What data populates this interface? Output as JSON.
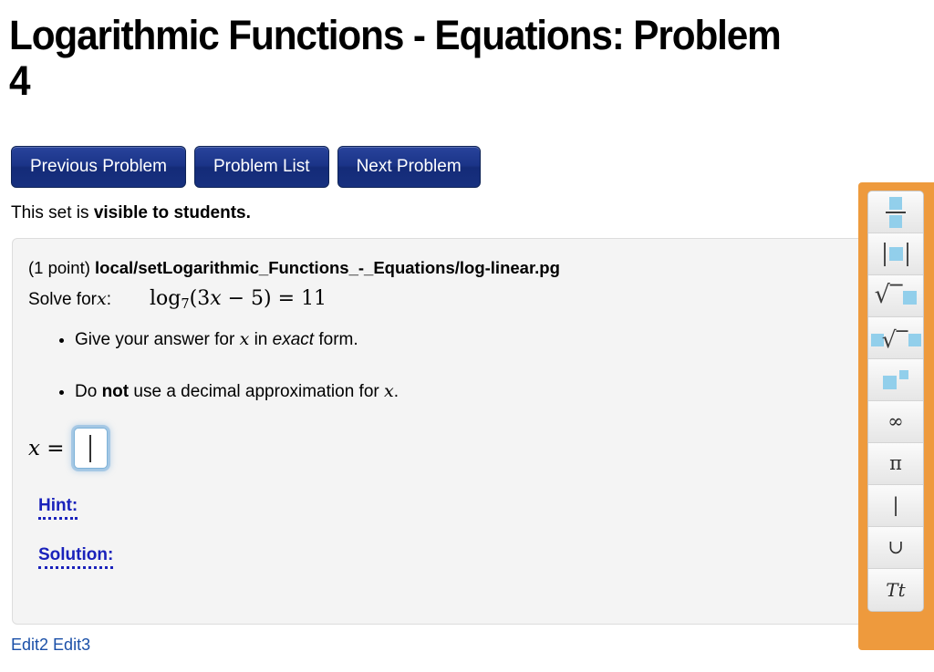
{
  "header": {
    "title": "Logarithmic Functions - Equations: Problem 4"
  },
  "nav": {
    "buttons": [
      {
        "label": "Previous Problem",
        "name": "previous-problem-button"
      },
      {
        "label": "Problem List",
        "name": "problem-list-button"
      },
      {
        "label": "Next Problem",
        "name": "next-problem-button"
      }
    ]
  },
  "visibility": {
    "prefix": "This set is ",
    "status": "visible to students."
  },
  "problem": {
    "points": "(1 point) ",
    "source_path": "local/setLogarithmic_Functions_-_Equations/log-linear.pg",
    "solve_label": "Solve for ",
    "solve_var": "x",
    "solve_colon": ":",
    "equation_plain": "log_7(3x - 5) = 11",
    "equation": {
      "func": "log",
      "base": "7",
      "open": "(",
      "coef": "3",
      "var": "x",
      "minus": " − ",
      "const": "5",
      "close": ")",
      "equals": " = ",
      "rhs": "11"
    },
    "bullets": [
      {
        "pre": "Give your answer for ",
        "var": "x",
        "mid": " in ",
        "em": "exact",
        "post": " form."
      },
      {
        "pre": "Do ",
        "strong": "not",
        "mid": " use a decimal approximation for ",
        "var": "x",
        "post": "."
      }
    ],
    "answer": {
      "var": "x",
      "equals": " =",
      "value": "",
      "placeholder": ""
    },
    "hint_label": "Hint:",
    "solution_label": "Solution:"
  },
  "footer": {
    "links": [
      {
        "label": "Edit2",
        "name": "edit2-link"
      },
      {
        "label": "Edit3",
        "name": "edit3-link"
      }
    ]
  },
  "palette": {
    "border_color": "#ee9a3d",
    "placeholder_color": "#92cfeb",
    "buttons": [
      {
        "name": "fraction-icon",
        "label": "fraction",
        "glyph": ""
      },
      {
        "name": "absolute-value-icon",
        "label": "absolute value",
        "glyph": ""
      },
      {
        "name": "square-root-icon",
        "label": "square root",
        "glyph": ""
      },
      {
        "name": "nth-root-icon",
        "label": "nth root",
        "glyph": ""
      },
      {
        "name": "exponent-icon",
        "label": "exponent",
        "glyph": ""
      },
      {
        "name": "infinity-icon",
        "label": "infinity",
        "glyph": "∞"
      },
      {
        "name": "pi-icon",
        "label": "pi",
        "glyph": "π"
      },
      {
        "name": "vertical-bar-icon",
        "label": "vertical bar",
        "glyph": "|"
      },
      {
        "name": "union-icon",
        "label": "union",
        "glyph": "∪"
      },
      {
        "name": "text-mode-icon",
        "label": "text mode",
        "glyph": "Tt"
      }
    ]
  },
  "colors": {
    "button_blue": "#1b3488",
    "link_blue": "#1b50a8",
    "hint_blue": "#1a22bb",
    "panel_bg": "#f4f4f4",
    "palette_orange": "#ee9a3d"
  }
}
